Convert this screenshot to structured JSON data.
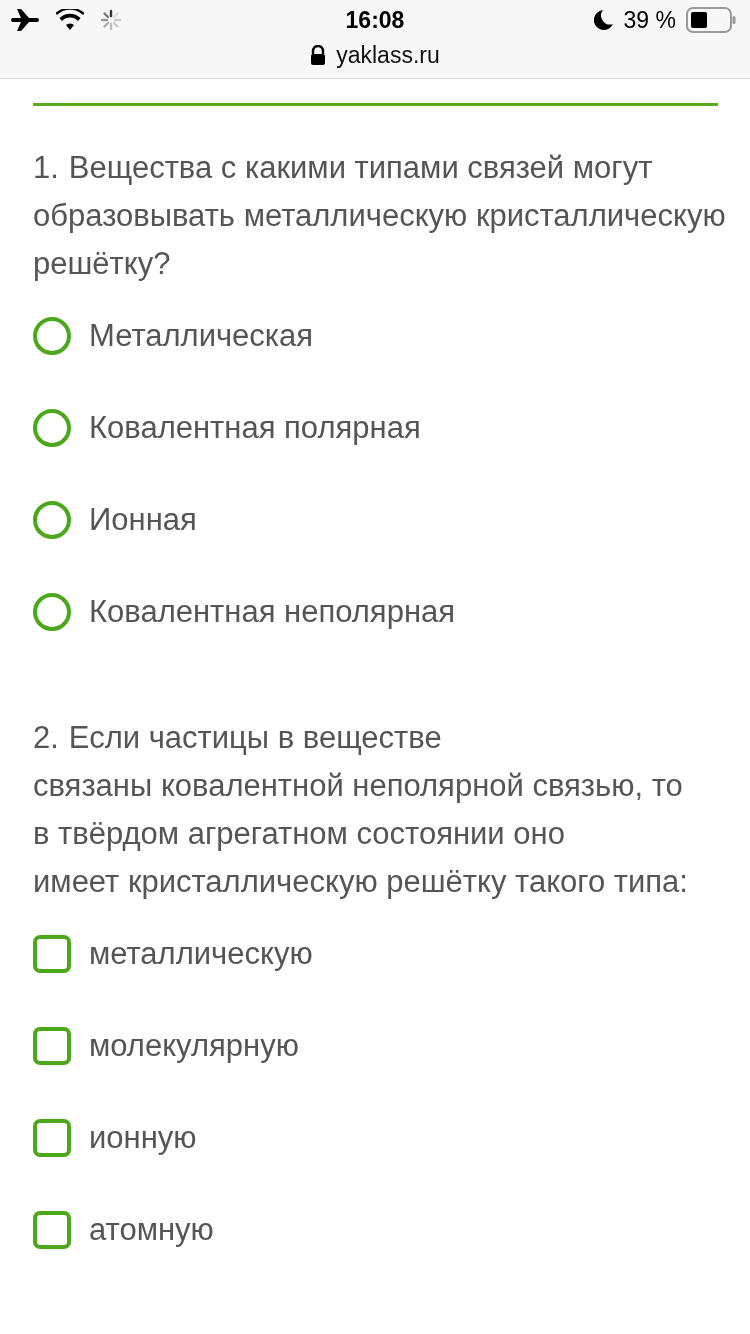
{
  "status_bar": {
    "time": "16:08",
    "battery": "39 %"
  },
  "browser": {
    "url": "yaklass.ru"
  },
  "questions": [
    {
      "number": "1.",
      "lines": [
        "Вещества с какими типами связей могут",
        "образовывать металлическую кристаллическую",
        "решётку?"
      ],
      "kind": "radio",
      "options": [
        {
          "label": "Металлическая",
          "selected": false
        },
        {
          "label": "Ковалентная полярная",
          "selected": false
        },
        {
          "label": "Ионная",
          "selected": false
        },
        {
          "label": "Ковалентная неполярная",
          "selected": false
        }
      ]
    },
    {
      "number": "2.",
      "lines": [
        "Если частицы в веществе",
        "связаны ковалентной неполярной связью, то",
        "в твёрдом агрегатном состоянии оно",
        "имеет кристаллическую решётку такого типа:"
      ],
      "kind": "checkbox",
      "options": [
        {
          "label": "металлическую",
          "selected": false
        },
        {
          "label": "молекулярную",
          "selected": false
        },
        {
          "label": "ионную",
          "selected": false
        },
        {
          "label": "атомную",
          "selected": false
        }
      ]
    }
  ]
}
